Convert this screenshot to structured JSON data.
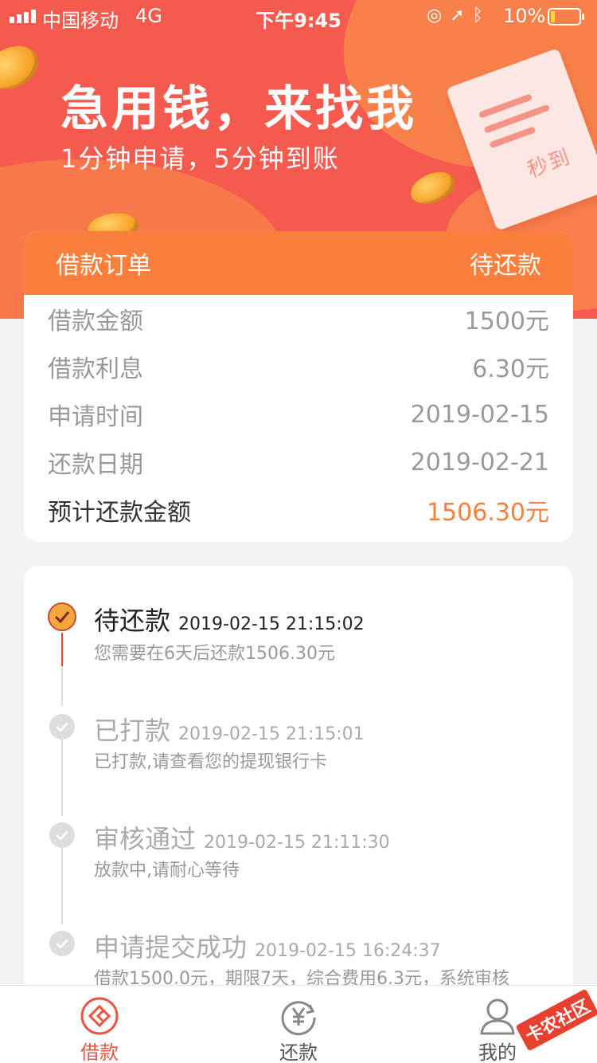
{
  "status_bar": {
    "carrier": "中国移动",
    "network": "4G",
    "time": "下午9:45",
    "battery_percent": "10%"
  },
  "hero": {
    "headline": "急用钱，来找我",
    "subline": "1分钟申请，5分钟到账",
    "receipt_stamp": "秒到"
  },
  "order": {
    "title": "借款订单",
    "status": "待还款",
    "rows": [
      {
        "label": "借款金额",
        "value": "1500元"
      },
      {
        "label": "借款利息",
        "value": "6.30元"
      },
      {
        "label": "申请时间",
        "value": "2019-02-15"
      },
      {
        "label": "还款日期",
        "value": "2019-02-21"
      }
    ],
    "total": {
      "label": "预计还款金额",
      "value": "1506.30元"
    }
  },
  "timeline": [
    {
      "title": "待还款",
      "time": "2019-02-15 21:15:02",
      "desc": "您需要在6天后还款1506.30元",
      "active": true
    },
    {
      "title": "已打款",
      "time": "2019-02-15 21:15:01",
      "desc": "已打款,请查看您的提现银行卡",
      "active": false
    },
    {
      "title": "审核通过",
      "time": "2019-02-15 21:11:30",
      "desc": "放款中,请耐心等待",
      "active": false
    },
    {
      "title": "申请提交成功",
      "time": "2019-02-15 16:24:37",
      "desc": "借款1500.0元，期限7天，综合费用6.3元，系统审核",
      "active": false
    }
  ],
  "tabbar": {
    "tabs": [
      {
        "label": "借款",
        "icon": "loan-icon",
        "active": true
      },
      {
        "label": "还款",
        "icon": "repay-icon",
        "active": false
      },
      {
        "label": "我的",
        "icon": "profile-icon",
        "active": false
      }
    ]
  },
  "watermark": "卡农社区",
  "colors": {
    "hero_red": "#f65a4e",
    "accent_orange": "#fb7f3c",
    "tab_active_red": "#ef5240"
  }
}
